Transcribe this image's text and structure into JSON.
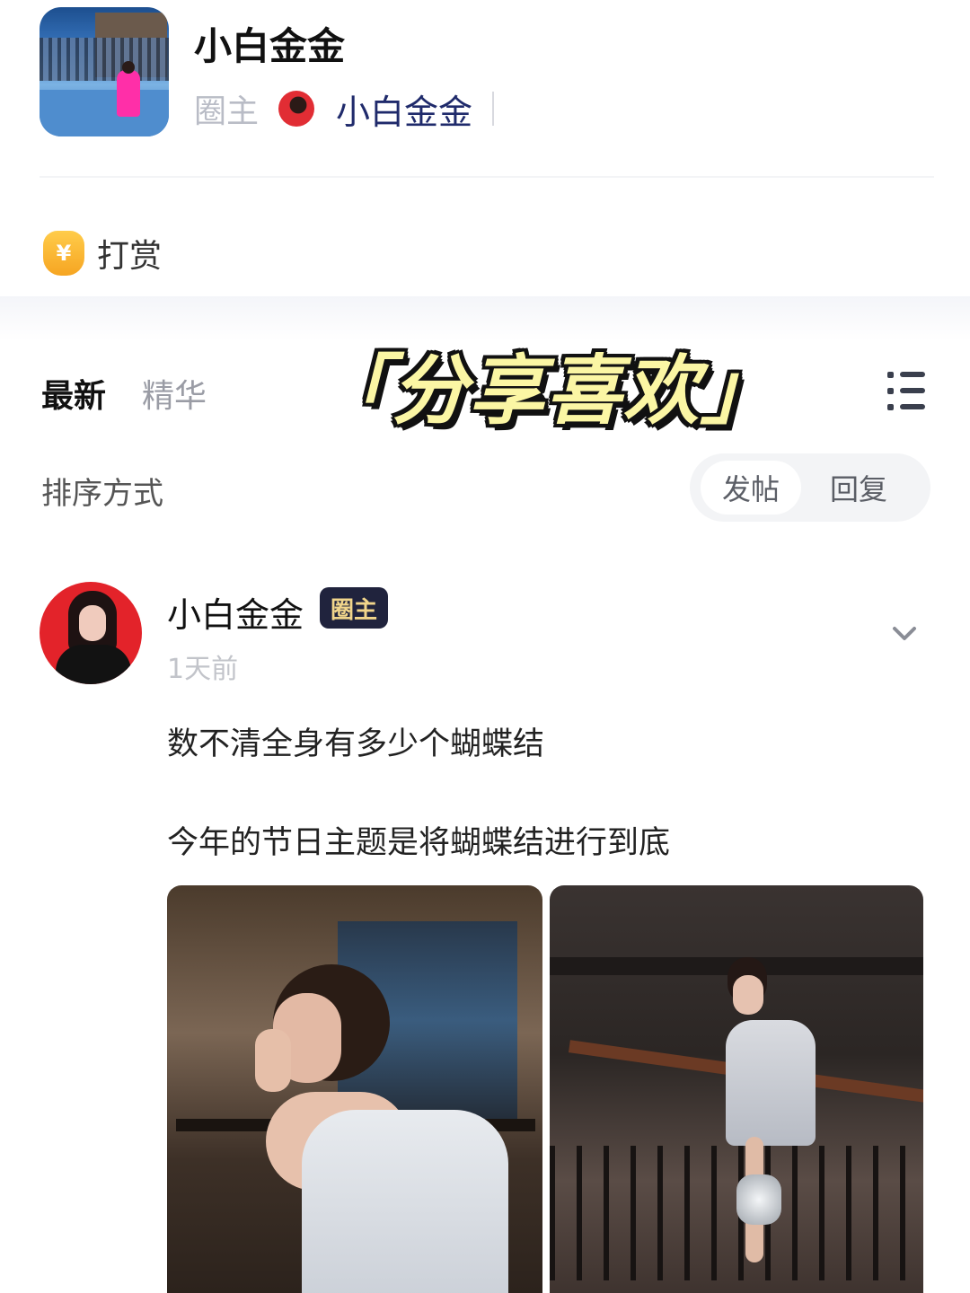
{
  "header": {
    "group_title": "小白金金",
    "owner_label": "圈主",
    "owner_name": "小白金金"
  },
  "reward": {
    "icon": "money-bag-icon",
    "icon_glyph": "¥",
    "label": "打赏"
  },
  "overlay_title": "「分享喜欢」",
  "tabs": [
    {
      "label": "最新",
      "active": true
    },
    {
      "label": "精华",
      "active": false
    }
  ],
  "sort": {
    "label": "排序方式",
    "options": [
      {
        "label": "发帖",
        "active": true
      },
      {
        "label": "回复",
        "active": false
      }
    ]
  },
  "post": {
    "author": "小白金金",
    "badge": "圈主",
    "time": "1天前",
    "lines": [
      "数不清全身有多少个蝴蝶结",
      "今年的节日主题是将蝴蝶结进行到底"
    ]
  },
  "colors": {
    "accent_dark_blue": "#1f2a6b",
    "badge_bg": "#20233d",
    "badge_text": "#f1d58b",
    "overlay_text": "#fbf6a4"
  }
}
